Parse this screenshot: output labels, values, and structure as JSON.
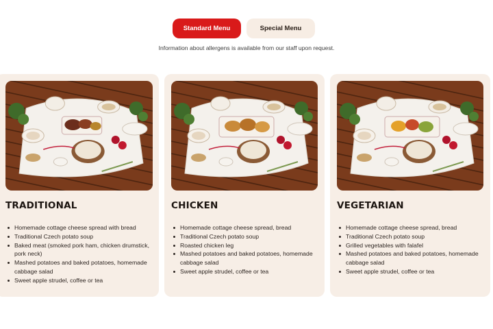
{
  "tabs": {
    "standard_label": "Standard Menu",
    "special_label": "Special Menu",
    "active": "Standard Menu"
  },
  "allergen_note": "Information about allergens is available from our staff upon request.",
  "colors": {
    "accent": "#d91a1a",
    "card_bg": "#f7eee6",
    "tab_inactive_bg": "#f7ede4"
  },
  "menus": [
    {
      "title": "TRADITIONAL",
      "photo": "food-photo-traditional",
      "items": [
        "Homemade cottage cheese spread with bread",
        "Traditional Czech potato soup",
        "Baked meat (smoked pork ham, chicken drumstick, pork neck)",
        "Mashed potatoes and baked potatoes, homemade cabbage salad",
        "Sweet apple strudel, coffee or tea"
      ]
    },
    {
      "title": "CHICKEN",
      "photo": "food-photo-chicken",
      "items": [
        "Homemade cottage cheese spread, bread",
        "Traditional Czech potato soup",
        "Roasted chicken leg",
        "Mashed potatoes and baked potatoes, homemade cabbage salad",
        "Sweet apple strudel, coffee or tea"
      ]
    },
    {
      "title": "VEGETARIAN",
      "photo": "food-photo-vegetarian",
      "items": [
        "Homemade cottage cheese spread, bread",
        "Traditional Czech potato soup",
        "Grilled vegetables with falafel",
        "Mashed potatoes and baked potatoes, homemade cabbage salad",
        "Sweet apple strudel, coffee or tea"
      ]
    }
  ]
}
